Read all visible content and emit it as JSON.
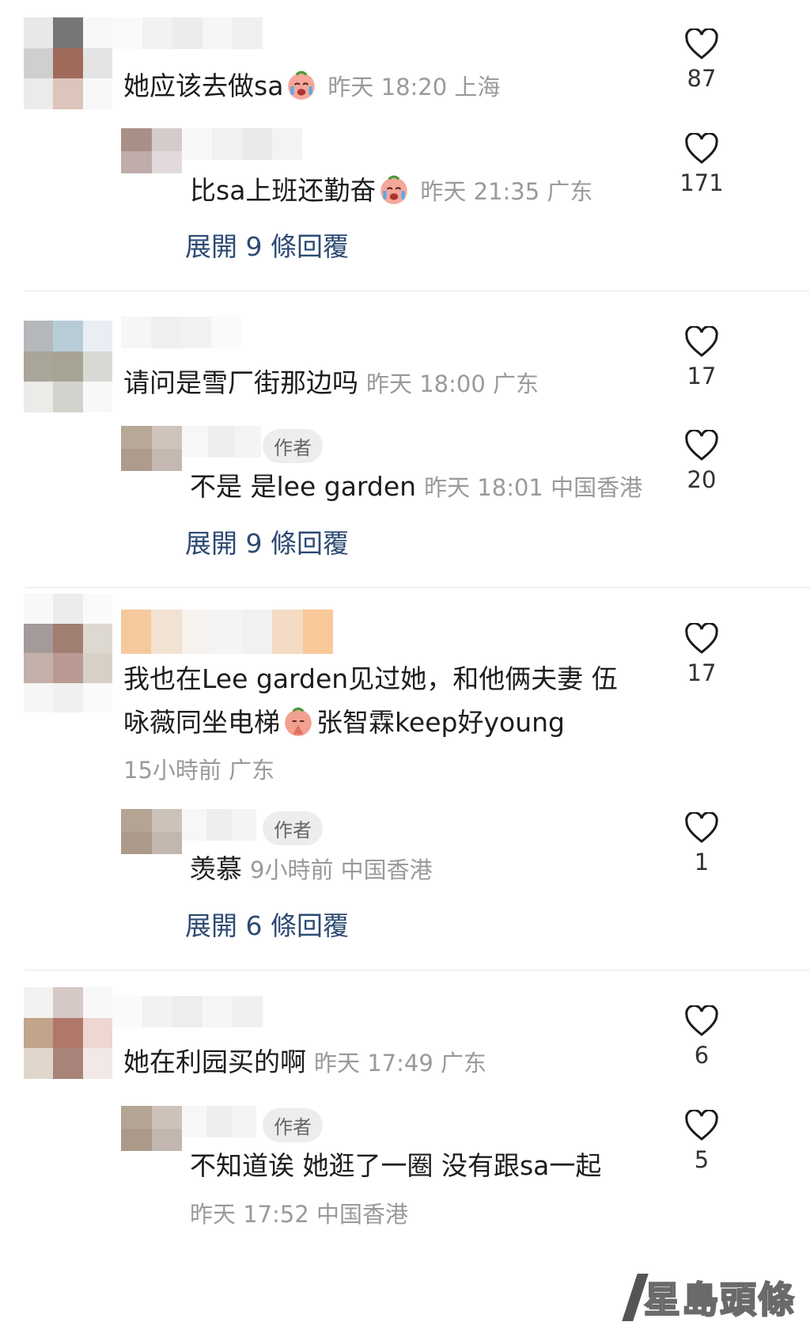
{
  "comments": [
    {
      "text": "她应该去做sa",
      "meta": "昨天 18:20 上海",
      "likes": "87",
      "reply": {
        "text": "比sa上班还勤奋",
        "meta": "昨天 21:35 广东",
        "likes": "171",
        "is_author": false
      },
      "expand": "展開 9 條回覆"
    },
    {
      "text": "请问是雪厂街那边吗",
      "meta": "昨天 18:00 广东",
      "likes": "17",
      "reply": {
        "text": "不是 是lee garden",
        "meta": "昨天 18:01 中国香港",
        "likes": "20",
        "is_author": true
      },
      "expand": "展開 9 條回覆"
    },
    {
      "text_line1": "我也在Lee garden见过她，和他俩夫妻 伍",
      "text_line2_a": "咏薇同坐电梯",
      "text_line2_b": "张智霖keep好young",
      "meta": "15小時前 广东",
      "likes": "17",
      "reply": {
        "text": "羡慕",
        "meta": "9小時前 中国香港",
        "likes": "1",
        "is_author": true
      },
      "expand": "展開 6 條回覆"
    },
    {
      "text": "她在利园买的啊",
      "meta": "昨天 17:49 广东",
      "likes": "6",
      "reply": {
        "text": "不知道诶 她逛了一圈 没有跟sa一起",
        "meta": "昨天 17:52 中国香港",
        "likes": "5",
        "is_author": true
      }
    }
  ],
  "author_badge": "作者",
  "watermark": "星島頭條",
  "icons": {
    "like": "heart-outline-icon",
    "emoji_cry": "crying-face-icon",
    "emoji_pray": "praying-face-icon"
  },
  "colors": {
    "expand_link": "#2d4a73",
    "meta": "#9a9a9a",
    "badge_bg": "#ededed"
  }
}
